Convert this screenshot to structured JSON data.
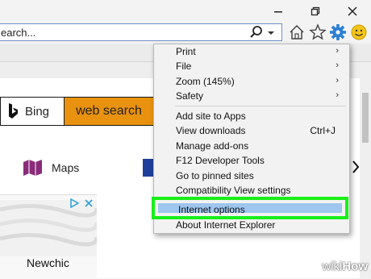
{
  "address_bar": {
    "text": "earch..."
  },
  "page": {
    "bing_label": "Bing",
    "web_search_label": "web search",
    "maps_label": "Maps",
    "ad_brand": "Newchic"
  },
  "menu": {
    "items": [
      {
        "label": "Print",
        "submenu": true
      },
      {
        "label": "File",
        "submenu": true
      },
      {
        "label": "Zoom (145%)",
        "submenu": true
      },
      {
        "label": "Safety",
        "submenu": true
      },
      {
        "label": "Add site to Apps"
      },
      {
        "label": "View downloads",
        "shortcut": "Ctrl+J"
      },
      {
        "label": "Manage add-ons"
      },
      {
        "label": "F12 Developer Tools"
      },
      {
        "label": "Go to pinned sites"
      },
      {
        "label": "Compatibility View settings"
      },
      {
        "label": "Internet options",
        "highlighted": true
      },
      {
        "label": "About Internet Explorer"
      }
    ]
  },
  "watermark": {
    "wiki": "wiki",
    "how": "How"
  },
  "colors": {
    "highlight_border": "#18ef18",
    "highlight_fill": "#9ec6ee",
    "web_search_bg": "#e8920f",
    "gear_icon": "#2a7fd4",
    "smiley": "#f5c518"
  },
  "icons": [
    "minimize-icon",
    "restore-icon",
    "close-icon",
    "search-icon",
    "dropdown-icon",
    "home-icon",
    "favorites-star-icon",
    "settings-gear-icon",
    "smiley-feedback-icon",
    "bing-logo-icon",
    "maps-icon",
    "ad-choices-icon",
    "ad-close-icon",
    "chevron-right-icon",
    "submenu-arrow-icon"
  ]
}
